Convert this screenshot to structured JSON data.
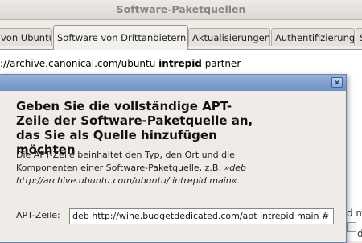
{
  "window": {
    "title": "Software-Paketquellen"
  },
  "tabs": [
    {
      "label": "von Ubuntu"
    },
    {
      "label": "Software von Drittanbietern"
    },
    {
      "label": "Aktualisierungen"
    },
    {
      "label": "Authentifizierung"
    },
    {
      "label": "S"
    }
  ],
  "source_list": {
    "row1_prefix": "://archive.canonical.com/ubuntu ",
    "row1_suite": "intrepid",
    "row1_component": " partner",
    "partial_rows": [
      "d m",
      "d m"
    ]
  },
  "dialog": {
    "close_glyph": "×",
    "heading": "Geben Sie die vollständige APT-Zeile der Software-Paketquelle an, das Sie als Quelle hinzufügen möchten",
    "body_text": "Die APT-Zeile beinhaltet den Typ, den Ort und die Komponenten einer Software-Paketquelle, z.B.",
    "body_example": "»deb http://archive.ubuntu.com/ubuntu/ intrepid main«.",
    "apt_label": "APT-Zeile:",
    "apt_value": "deb http://wine.budgetdedicated.com/apt intrepid main #"
  },
  "colors": {
    "dialog_titlebar": "#7a9bcb",
    "window_bg": "#efebe7"
  }
}
